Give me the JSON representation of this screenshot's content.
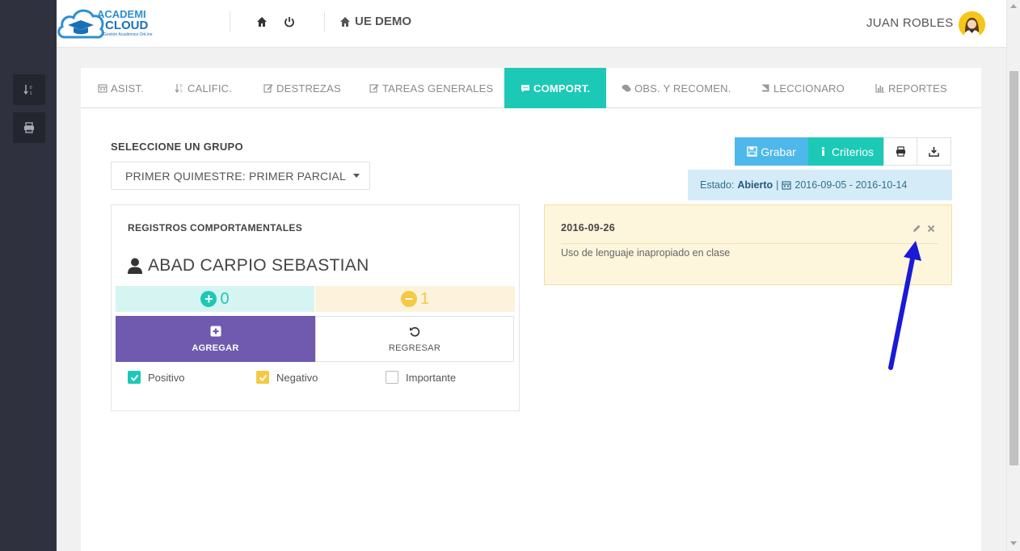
{
  "logo": {
    "line1": "ACADEMI",
    "line2": "CLOUD",
    "tagline": "Gestión Académica OnLine"
  },
  "header": {
    "school": "UE DEMO",
    "user": "JUAN ROBLES"
  },
  "tabs": [
    {
      "label": "ASIST.",
      "icon": "calendar-icon",
      "active": false
    },
    {
      "label": "CALIFIC.",
      "icon": "sort-numeric-icon",
      "active": false
    },
    {
      "label": "DESTREZAS",
      "icon": "edit-icon",
      "active": false
    },
    {
      "label": "TAREAS GENERALES",
      "icon": "edit-icon",
      "active": false
    },
    {
      "label": "COMPORT.",
      "icon": "comment-icon",
      "active": true
    },
    {
      "label": "OBS. Y RECOMEN.",
      "icon": "comments-icon",
      "active": false
    },
    {
      "label": "LECCIONARO",
      "icon": "book-icon",
      "active": false
    },
    {
      "label": "REPORTES",
      "icon": "bar-chart-icon",
      "active": false
    }
  ],
  "group": {
    "label": "SELECCIONE UN GRUPO",
    "selected": "PRIMER QUIMESTRE: PRIMER PARCIAL"
  },
  "records": {
    "title": "REGISTROS COMPORTAMENTALES",
    "student": "ABAD CARPIO SEBASTIAN",
    "positive_count": "0",
    "negative_count": "1",
    "add_label": "AGREGAR",
    "back_label": "REGRESAR",
    "checks": [
      {
        "label": "Positivo",
        "checked": true,
        "color": "#1cc9b6"
      },
      {
        "label": "Negativo",
        "checked": true,
        "color": "#f6c944"
      },
      {
        "label": "Importante",
        "checked": false
      }
    ]
  },
  "actions": {
    "save": "Grabar",
    "criteria": "Criterios"
  },
  "status": {
    "prefix": "Estado:",
    "value": "Abierto",
    "separator": "|",
    "range": "2016-09-05 - 2016-10-14"
  },
  "note": {
    "date": "2016-09-26",
    "text": "Uso de lenguaje inapropiado en clase"
  },
  "colors": {
    "teal": "#1cc9b6",
    "purple": "#6f5aaf",
    "blue": "#4fb8ea",
    "yellow": "#f6c944",
    "sidebar": "#2f323e",
    "arrow": "#1a1ad6"
  }
}
